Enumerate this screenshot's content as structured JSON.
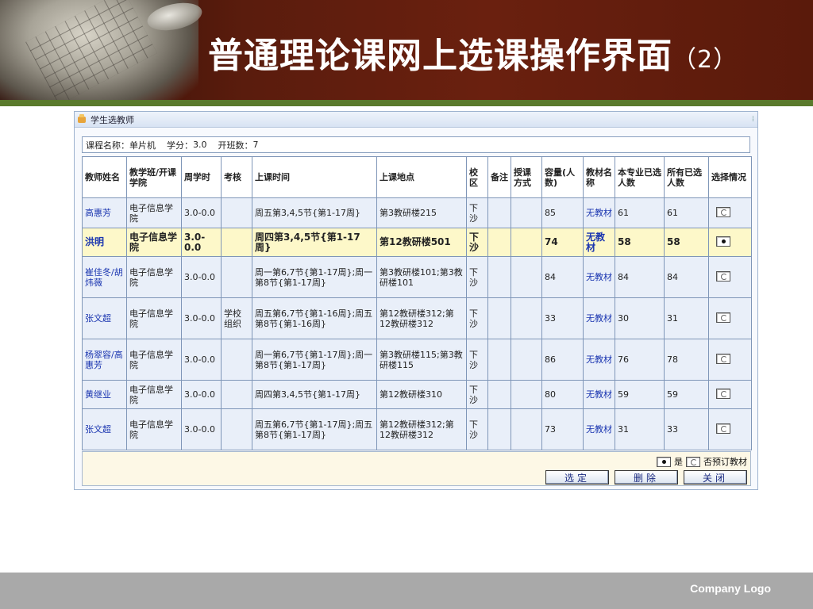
{
  "slide": {
    "title": "普通理论课网上选课操作界面",
    "title_suffix": "（2）",
    "company_logo": "Company Logo"
  },
  "window": {
    "title": "学生选教师",
    "icon": "folder-icon"
  },
  "course": {
    "name_label": "课程名称：",
    "name": "单片机",
    "credit_label": "学分：",
    "credit": "3.0",
    "classes_label": "开班数：",
    "classes": "7"
  },
  "table": {
    "headers": [
      "教师姓名",
      "教学班/开课学院",
      "周学时",
      "考核",
      "上课时间",
      "上课地点",
      "校区",
      "备注",
      "授课方式",
      "容量(人数)",
      "教材名称",
      "本专业已选人数",
      "所有已选人数",
      "选择情况"
    ],
    "rows": [
      {
        "teacher": "高惠芳",
        "college": "电子信息学院",
        "hours": "3.0-0.0",
        "exam": "",
        "time": "周五第3,4,5节{第1-17周}",
        "place": "第3教研楼215",
        "campus": "下沙",
        "note": "",
        "mode": "",
        "capacity": "85",
        "textbook": "无教材",
        "major": "61",
        "total": "61",
        "checked": false
      },
      {
        "teacher": "洪明",
        "college": "电子信息学院",
        "hours": "3.0-0.0",
        "exam": "",
        "time": "周四第3,4,5节{第1-17周}",
        "place": "第12教研楼501",
        "campus": "下沙",
        "note": "",
        "mode": "",
        "capacity": "74",
        "textbook": "无教材",
        "major": "58",
        "total": "58",
        "checked": true
      },
      {
        "teacher": "崔佳冬/胡炜薇",
        "college": "电子信息学院",
        "hours": "3.0-0.0",
        "exam": "",
        "time": "周一第6,7节{第1-17周};周一第8节{第1-17周}",
        "place": "第3教研楼101;第3教研楼101",
        "campus": "下沙",
        "note": "",
        "mode": "",
        "capacity": "84",
        "textbook": "无教材",
        "major": "84",
        "total": "84",
        "checked": false
      },
      {
        "teacher": "张文超",
        "college": "电子信息学院",
        "hours": "3.0-0.0",
        "exam": "学校组织",
        "time": "周五第6,7节{第1-16周};周五第8节{第1-16周}",
        "place": "第12教研楼312;第12教研楼312",
        "campus": "下沙",
        "note": "",
        "mode": "",
        "capacity": "33",
        "textbook": "无教材",
        "major": "30",
        "total": "31",
        "checked": false
      },
      {
        "teacher": "杨翠容/高惠芳",
        "college": "电子信息学院",
        "hours": "3.0-0.0",
        "exam": "",
        "time": "周一第6,7节{第1-17周};周一第8节{第1-17周}",
        "place": "第3教研楼115;第3教研楼115",
        "campus": "下沙",
        "note": "",
        "mode": "",
        "capacity": "86",
        "textbook": "无教材",
        "major": "76",
        "total": "78",
        "checked": false
      },
      {
        "teacher": "黄继业",
        "college": "电子信息学院",
        "hours": "3.0-0.0",
        "exam": "",
        "time": "周四第3,4,5节{第1-17周}",
        "place": "第12教研楼310",
        "campus": "下沙",
        "note": "",
        "mode": "",
        "capacity": "80",
        "textbook": "无教材",
        "major": "59",
        "total": "59",
        "checked": false
      },
      {
        "teacher": "张文超",
        "college": "电子信息学院",
        "hours": "3.0-0.0",
        "exam": "",
        "time": "周五第6,7节{第1-17周};周五第8节{第1-17周}",
        "place": "第12教研楼312;第12教研楼312",
        "campus": "下沙",
        "note": "",
        "mode": "",
        "capacity": "73",
        "textbook": "无教材",
        "major": "31",
        "total": "33",
        "checked": false
      }
    ]
  },
  "options": {
    "yes_label": "是",
    "no_label": "否预订教材",
    "yes_selected": true
  },
  "buttons": {
    "select": "选定",
    "delete": "删除",
    "close": "关闭"
  },
  "colors": {
    "banner": "#5a1c0d",
    "banner_stripe": "#5a7a2c",
    "link": "#1a35b0",
    "row_bg": "#e9eff9",
    "selected_row_bg": "#fdf8c9",
    "footer": "#a9a9a9"
  }
}
